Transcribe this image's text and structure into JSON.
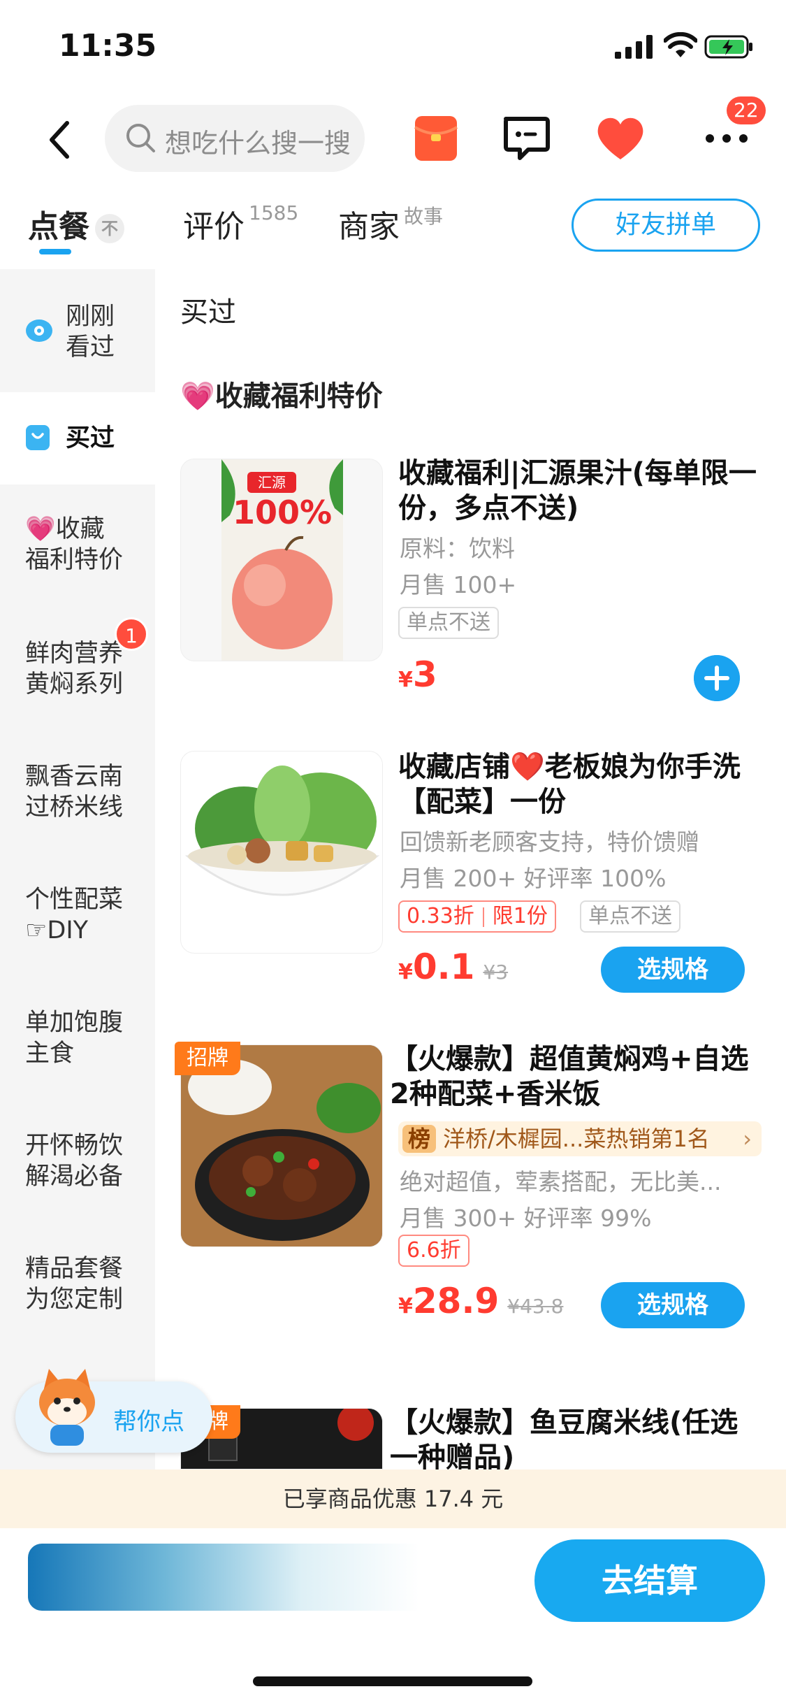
{
  "status_bar": {
    "time": "11:35"
  },
  "header": {
    "search_placeholder": "想吃什么搜一搜",
    "more_badge": "22"
  },
  "tabs": {
    "order": "点餐",
    "order_pin": "不",
    "reviews": "评价",
    "reviews_count": "1585",
    "merchant": "商家",
    "merchant_sup": "故事",
    "friend_group_button": "好友拼单"
  },
  "sidebar": {
    "items": [
      {
        "label_line1": "刚刚",
        "label_line2": "看过"
      },
      {
        "label_line1": "买过",
        "label_line2": ""
      },
      {
        "label_line1": "💗收藏",
        "label_line2": "福利特价"
      },
      {
        "label_line1": "鲜肉营养",
        "label_line2": "黄焖系列",
        "badge": "1"
      },
      {
        "label_line1": "飘香云南",
        "label_line2": "过桥米线"
      },
      {
        "label_line1": "个性配菜",
        "label_line2": "☞DIY"
      },
      {
        "label_line1": "单加饱腹",
        "label_line2": "主食"
      },
      {
        "label_line1": "开怀畅饮",
        "label_line2": "解渴必备"
      },
      {
        "label_line1": "精品套餐",
        "label_line2": "为您定制"
      }
    ]
  },
  "main": {
    "section_bought": "买过",
    "section_fav": "💗收藏福利特价",
    "products": [
      {
        "name": "收藏福利|汇源果汁(每单限一份，多点不送)",
        "desc": "原料：饮料",
        "sales": "月售 100+",
        "tag": "单点不送",
        "currency": "¥",
        "price": "3"
      },
      {
        "name": "收藏店铺❤️老板娘为你手洗【配菜】一份",
        "desc": "回馈新老顾客支持，特价馈赠",
        "sales": "月售 200+ 好评率 100%",
        "discount": "0.33折",
        "limit": "限1份",
        "tag": "单点不送",
        "currency": "¥",
        "price": "0.1",
        "orig_price": "¥3",
        "button": "选规格"
      },
      {
        "ribbon": "招牌",
        "name": "【火爆款】超值黄焖鸡+自选2种配菜+香米饭",
        "rank_badge": "榜",
        "rank_text": "洋桥/木樨园...菜热销第1名",
        "desc": "绝对超值，荤素搭配，无比美...",
        "sales": "月售 300+ 好评率 99%",
        "discount": "6.6折",
        "currency": "¥",
        "price": "28.9",
        "orig_price": "¥43.8",
        "button": "选规格"
      },
      {
        "ribbon": "招牌",
        "name": "【火爆款】鱼豆腐米线(任选一种赠品)"
      }
    ]
  },
  "helper": {
    "label": "帮你点"
  },
  "bottom": {
    "discount_notice": "已享商品优惠 17.4 元",
    "checkout": "去结算"
  },
  "colors": {
    "accent": "#1aa3f0",
    "price": "#ff3b30",
    "badge": "#ff4d3d",
    "ribbon": "#ff7a1a"
  }
}
